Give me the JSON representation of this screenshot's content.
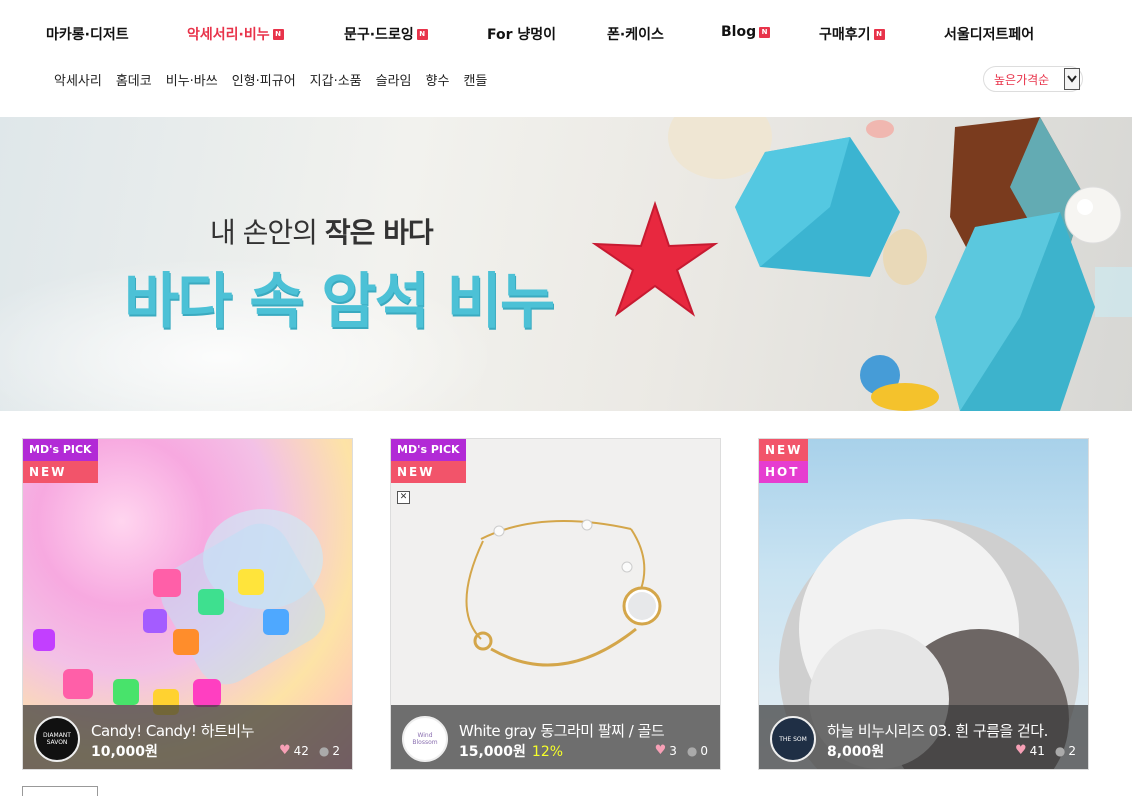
{
  "nav": {
    "items": [
      {
        "label": "마카롱·디저트",
        "badge": ""
      },
      {
        "label": "악세서리·비누",
        "badge": "N"
      },
      {
        "label": "문구·드로잉",
        "badge": "N"
      },
      {
        "label": "For 냥멍이",
        "badge": ""
      },
      {
        "label": "폰·케이스",
        "badge": ""
      },
      {
        "label": "Blog",
        "badge": "N"
      },
      {
        "label": "구매후기",
        "badge": "N"
      },
      {
        "label": "서울디저트페어",
        "badge": ""
      }
    ],
    "active_color": "#e8334a"
  },
  "subnav": {
    "items": [
      "악세사리",
      "홈데코",
      "비누·바쓰",
      "인형·피규어",
      "지갑·소품",
      "슬라임",
      "향수",
      "캔들"
    ]
  },
  "sort": {
    "selected": "높은가격순"
  },
  "banner": {
    "line1_prefix": "내 손안의 ",
    "line1_bold": "작은 바다",
    "line2": "바다 속 암석 비누"
  },
  "products": [
    {
      "tags": [
        "MD's PICK",
        "NEW"
      ],
      "title": "Candy! Candy! 하트비누",
      "price": "10,000원",
      "discount": "",
      "likes": "42",
      "comments": "2",
      "logo": "DIAMANT SAVON"
    },
    {
      "tags": [
        "MD's PICK",
        "NEW"
      ],
      "title": "White gray 동그라미 팔찌 / 골드",
      "price": "15,000원",
      "discount": "12%",
      "likes": "3",
      "comments": "0",
      "logo": "Wind Blossom"
    },
    {
      "tags": [
        "NEW",
        "HOT"
      ],
      "title": "하늘 비누시리즈 03. 흰 구름을 걷다.",
      "price": "8,000원",
      "discount": "",
      "likes": "41",
      "comments": "2",
      "logo": "THE SOM"
    }
  ],
  "colors": {
    "tag_md": "#b22ad6",
    "tag_new": "#f2546a",
    "tag_hot": "#e63dd0",
    "banner_title": "#4cc1d6",
    "discount": "#f6ff2a"
  }
}
